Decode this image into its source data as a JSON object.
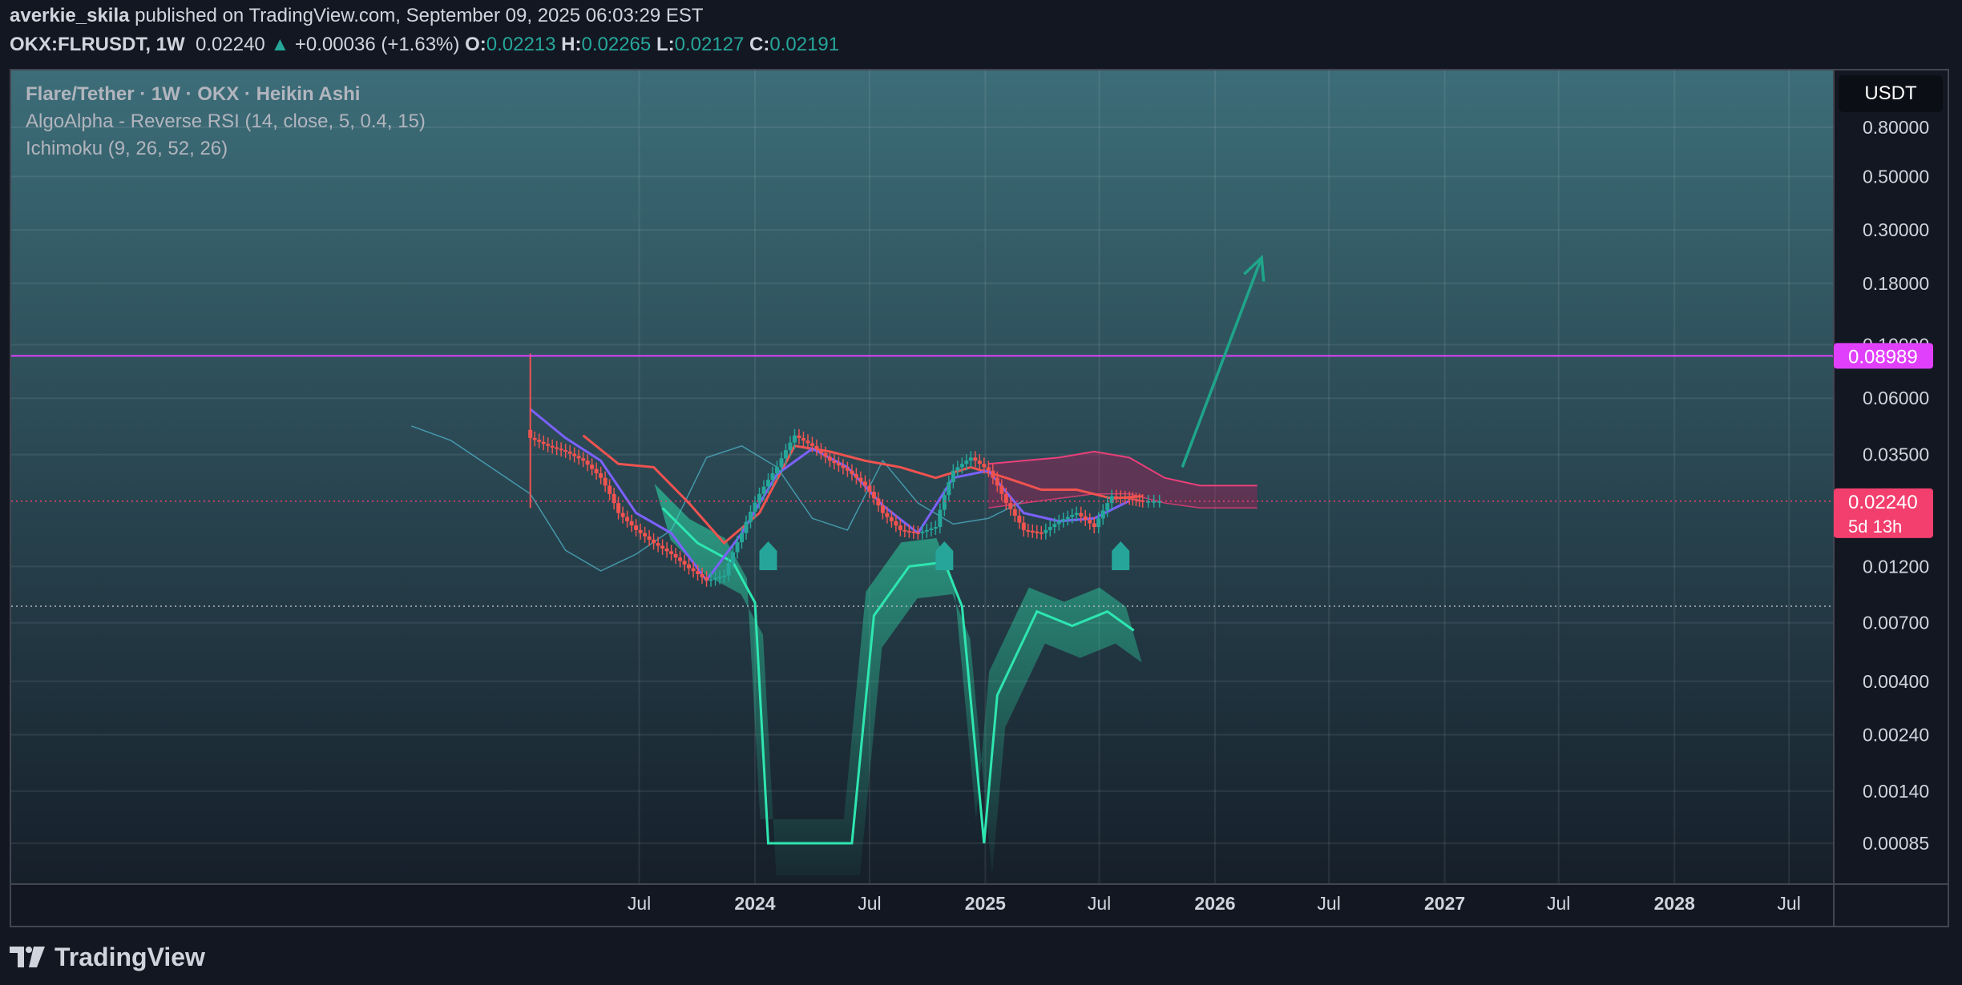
{
  "header": {
    "author": "averkie_skila",
    "published_text": "published on TradingView.com, September 09, 2025 06:03:29 EST",
    "symbol": "OKX:FLRUSDT, 1W",
    "price": "0.02240",
    "change_arrow": "▲",
    "change": "+0.00036 (+1.63%)",
    "o_label": "O:",
    "o_value": "0.02213",
    "h_label": "H:",
    "h_value": "0.02265",
    "l_label": "L:",
    "l_value": "0.02127",
    "c_label": "C:",
    "c_value": "0.02191"
  },
  "legend": {
    "main": "Flare/Tether · 1W · OKX · Heikin Ashi",
    "indicator1": "AlgoAlpha - Reverse RSI (14, close, 5, 0.4, 15)",
    "indicator2": "Ichimoku (9, 26, 52, 26)"
  },
  "currency_badge": "USDT",
  "price_tag": {
    "value": "0.02240",
    "countdown": "5d 13h"
  },
  "level_tag": {
    "value": "0.08989"
  },
  "footer": {
    "logo_text": "TradingView"
  },
  "colors": {
    "bg": "#131722",
    "up": "#26a69a",
    "down": "#ef5350",
    "level_line": "#e040fb",
    "price_tag": "#f23f6e",
    "tenkan": "#7b61ff",
    "kijun": "#ef5350",
    "arrow": "#1fa58a",
    "rrsi": "#2ee6b0"
  },
  "chart_data": {
    "type": "line",
    "title": "Flare/Tether · 1W · OKX · Heikin Ashi",
    "y_scale": "log",
    "y_ticks": [
      "0.80000",
      "0.50000",
      "0.30000",
      "0.18000",
      "0.10000",
      "0.06000",
      "0.03500",
      "0.01200",
      "0.00700",
      "0.00400",
      "0.00240",
      "0.00140",
      "0.00085"
    ],
    "x_ticks": [
      "Jul",
      "2024",
      "Jul",
      "2025",
      "Jul",
      "2026",
      "Jul",
      "2027",
      "Jul",
      "2028",
      "Jul"
    ],
    "horizontal_levels": [
      {
        "name": "resistance",
        "value": 0.08989
      },
      {
        "name": "last-price",
        "value": 0.0224
      },
      {
        "name": "dotted-support",
        "value": 0.0082
      }
    ],
    "series": [
      {
        "type": "close",
        "x": [
          "2023-01-09",
          "2023-02-06",
          "2023-03-06",
          "2023-04-03",
          "2023-05-01",
          "2023-05-29",
          "2023-06-26",
          "2023-07-24",
          "2023-08-21",
          "2023-09-18",
          "2023-10-16",
          "2023-11-13",
          "2023-12-11",
          "2024-01-08",
          "2024-02-05",
          "2024-03-04",
          "2024-04-01",
          "2024-04-29",
          "2024-05-27",
          "2024-06-24",
          "2024-07-22",
          "2024-08-19",
          "2024-09-16",
          "2024-10-14",
          "2024-11-11",
          "2024-12-09",
          "2025-01-06",
          "2025-02-03",
          "2025-03-03",
          "2025-03-31",
          "2025-04-28",
          "2025-05-26",
          "2025-06-23",
          "2025-07-21",
          "2025-08-18",
          "2025-09-08"
        ],
        "values": [
          0.041,
          0.038,
          0.036,
          0.033,
          0.028,
          0.02,
          0.017,
          0.015,
          0.0135,
          0.0118,
          0.0105,
          0.011,
          0.0165,
          0.024,
          0.031,
          0.042,
          0.038,
          0.033,
          0.03,
          0.026,
          0.02,
          0.017,
          0.0165,
          0.0175,
          0.03,
          0.034,
          0.03,
          0.022,
          0.017,
          0.0165,
          0.0185,
          0.02,
          0.0175,
          0.0235,
          0.023,
          0.0224
        ]
      },
      {
        "type": "tenkan",
        "x": [
          "2023-01-09",
          "2023-03-06",
          "2023-05-01",
          "2023-06-26",
          "2023-08-21",
          "2023-10-16",
          "2023-12-11",
          "2024-02-05",
          "2024-04-01",
          "2024-05-27",
          "2024-07-22",
          "2024-09-16",
          "2024-11-11",
          "2025-01-06",
          "2025-03-03",
          "2025-04-28",
          "2025-06-23",
          "2025-08-18"
        ],
        "values": [
          0.054,
          0.041,
          0.033,
          0.02,
          0.0165,
          0.0105,
          0.0165,
          0.029,
          0.037,
          0.031,
          0.0215,
          0.0165,
          0.028,
          0.03,
          0.02,
          0.0185,
          0.019,
          0.0225
        ]
      },
      {
        "type": "kijun",
        "x": [
          "2023-04-03",
          "2023-05-29",
          "2023-07-24",
          "2023-09-18",
          "2023-11-13",
          "2024-01-08",
          "2024-03-04",
          "2024-04-29",
          "2024-06-24",
          "2024-08-19",
          "2024-10-14",
          "2024-12-09",
          "2025-02-03",
          "2025-03-31",
          "2025-05-26",
          "2025-07-21",
          "2025-09-08"
        ],
        "values": [
          0.042,
          0.032,
          0.031,
          0.022,
          0.015,
          0.02,
          0.038,
          0.036,
          0.033,
          0.031,
          0.028,
          0.031,
          0.028,
          0.025,
          0.025,
          0.023,
          0.0235
        ]
      },
      {
        "type": "lagging-span",
        "x": [
          "2022-07-04",
          "2022-09-05",
          "2022-11-07",
          "2023-01-09",
          "2023-03-06",
          "2023-05-01",
          "2023-06-26",
          "2023-08-21",
          "2023-10-16",
          "2023-12-11",
          "2024-02-05",
          "2024-04-01",
          "2024-05-27",
          "2024-07-22",
          "2024-09-16",
          "2024-11-11",
          "2025-01-06",
          "2025-03-03"
        ],
        "values": [
          0.046,
          0.04,
          0.031,
          0.024,
          0.014,
          0.0115,
          0.0135,
          0.017,
          0.034,
          0.038,
          0.031,
          0.019,
          0.017,
          0.033,
          0.022,
          0.018,
          0.019,
          0.0225
        ]
      },
      {
        "type": "cloud-senkou-a",
        "x": [
          "2025-01-06",
          "2025-03-03",
          "2025-04-28",
          "2025-06-23",
          "2025-08-18",
          "2025-10-13",
          "2025-12-08",
          "2026-02-02",
          "2026-03-09"
        ],
        "values": [
          0.032,
          0.033,
          0.034,
          0.036,
          0.034,
          0.028,
          0.026,
          0.026,
          0.026
        ]
      },
      {
        "type": "cloud-senkou-b",
        "x": [
          "2025-01-06",
          "2025-03-03",
          "2025-04-28",
          "2025-06-23",
          "2025-08-18",
          "2025-10-13",
          "2025-12-08",
          "2026-02-02",
          "2026-03-09"
        ],
        "values": [
          0.021,
          0.022,
          0.023,
          0.024,
          0.024,
          0.022,
          0.021,
          0.021,
          0.021
        ]
      },
      {
        "type": "reverse-rsi",
        "x": [
          "2023-08-07",
          "2023-10-02",
          "2023-11-27",
          "2024-01-01",
          "2024-01-22",
          "2024-06-03",
          "2024-07-08",
          "2024-09-02",
          "2024-10-28",
          "2024-11-25",
          "2024-12-30",
          "2025-01-20",
          "2025-03-24",
          "2025-05-19",
          "2025-07-14",
          "2025-08-25"
        ],
        "values": [
          0.021,
          0.015,
          0.0125,
          0.0085,
          0.00085,
          0.00085,
          0.0075,
          0.012,
          0.0125,
          0.0082,
          0.00085,
          0.0035,
          0.0078,
          0.0068,
          0.0078,
          0.0065
        ]
      }
    ],
    "signals": [
      {
        "date": "2024-01-22",
        "type": "buy"
      },
      {
        "date": "2024-10-28",
        "type": "buy"
      },
      {
        "date": "2025-08-04",
        "type": "buy"
      }
    ],
    "projection_arrow": {
      "from": {
        "x": "2025-11-10",
        "y": 0.031
      },
      "to": {
        "x": "2026-03-16",
        "y": 0.23
      }
    }
  }
}
